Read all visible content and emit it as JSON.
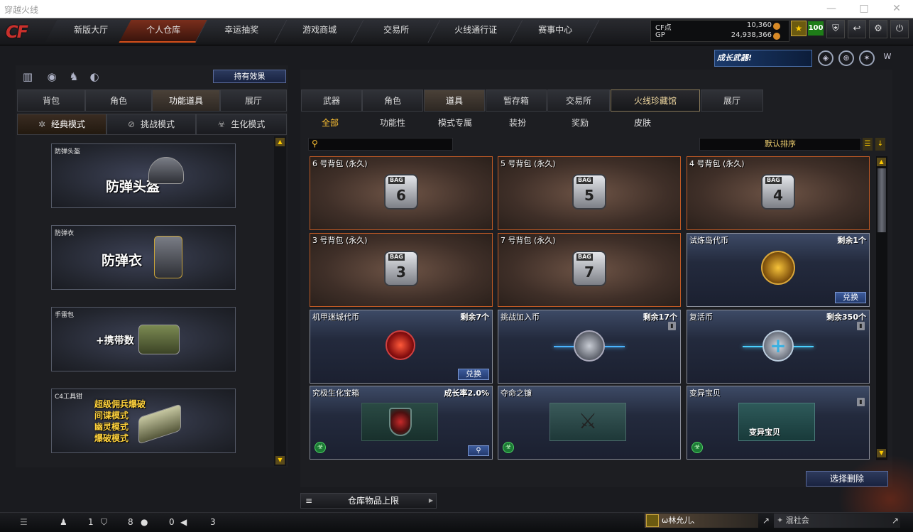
{
  "window": {
    "title": "穿越火线",
    "minimize": "—",
    "maximize": "□",
    "close": "✕"
  },
  "topnav": {
    "logo": "CF",
    "items": [
      "新版大厅",
      "个人仓库",
      "幸运抽奖",
      "游戏商城",
      "交易所",
      "火线通行证",
      "赛事中心"
    ],
    "active": 1
  },
  "currency": {
    "cf_label": "CF点",
    "cf_value": "10,360",
    "gp_label": "GP",
    "gp_value": "24,938,366"
  },
  "profile": {
    "level": "100"
  },
  "toolbar_icons": [
    "shield-icon",
    "exit-icon",
    "settings-icon",
    "power-icon"
  ],
  "promo": {
    "text": "成长武器!"
  },
  "left": {
    "effect_button": "持有效果",
    "tabs": [
      "背包",
      "角色",
      "功能道具",
      "展厅"
    ],
    "active_tab": 2,
    "mode_tabs": [
      "经典模式",
      "挑战模式",
      "生化模式"
    ],
    "active_mode": 0,
    "tools": [
      {
        "label": "防弹头盔",
        "title": "防弹头盔"
      },
      {
        "label": "防弹衣",
        "title": "防弹衣"
      },
      {
        "label": "手雷包",
        "title": "+携带数"
      },
      {
        "label": "C4工具钳",
        "lines": [
          "超级佣兵爆破",
          "间谍模式",
          "幽灵模式",
          "爆破模式"
        ]
      }
    ]
  },
  "right": {
    "tabs": [
      "武器",
      "角色",
      "道具",
      "暂存箱",
      "交易所",
      "火线珍藏馆",
      "展厅"
    ],
    "active_tab": 2,
    "subtabs": [
      "全部",
      "功能性",
      "模式专属",
      "装扮",
      "奖励",
      "皮肤"
    ],
    "active_sub": 0,
    "search_placeholder": "",
    "sort": "默认排序",
    "items": [
      {
        "name": "6 号背包 (永久)",
        "type": "bag",
        "num": "6"
      },
      {
        "name": "5 号背包 (永久)",
        "type": "bag",
        "num": "5"
      },
      {
        "name": "4 号背包 (永久)",
        "type": "bag",
        "num": "4"
      },
      {
        "name": "3 号背包 (永久)",
        "type": "bag",
        "num": "3"
      },
      {
        "name": "7 号背包 (永久)",
        "type": "bag",
        "num": "7"
      },
      {
        "name": "试炼岛代币",
        "remain": "剩余1个",
        "button": "兑换"
      },
      {
        "name": "机甲迷城代币",
        "remain": "剩余7个",
        "button": "兑换"
      },
      {
        "name": "挑战加入币",
        "remain": "剩余17个"
      },
      {
        "name": "复活币",
        "remain": "剩余350个"
      },
      {
        "name": "究极生化宝箱",
        "remain": "成长率2.0%"
      },
      {
        "name": "夺命之镰",
        "remain": ""
      },
      {
        "name": "变异宝贝",
        "remain": "",
        "img_text": "变异宝贝"
      }
    ],
    "delete_button": "选择删除",
    "warehouse_limit": "仓库物品上限"
  },
  "bottom": {
    "count1": "1",
    "count2": "8",
    "count3": "0",
    "count4": "3",
    "chat1": "ω林允儿、",
    "chat2": "混社会"
  },
  "colors": {
    "accent": "#ffc233",
    "card_border": "#c05a25",
    "active_nav": "#7a2e1c"
  }
}
